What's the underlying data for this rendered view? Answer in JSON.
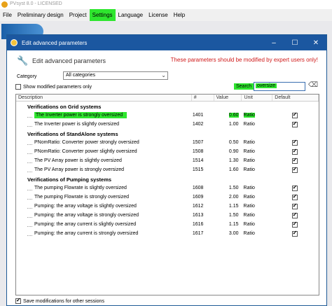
{
  "app": {
    "title": "PVsyst 8.0 - LICENSED",
    "menu": [
      "File",
      "Preliminary design",
      "Project",
      "Settings",
      "Language",
      "License",
      "Help"
    ]
  },
  "dialog": {
    "title": "Edit advanced parameters",
    "header": "Edit advanced parameters",
    "warning": "These parameters should be modified by expert users only!",
    "category_label": "Category",
    "category_value": "All categories",
    "show_modified_label": "Show modified parameters only",
    "search_label": "Search",
    "search_value": "oversize",
    "save_label": "Save modifications for other sessions"
  },
  "table": {
    "columns": [
      "Description",
      "#",
      "Value",
      "Unit",
      "Default"
    ],
    "groups": [
      {
        "title": "Verifications on Grid systems",
        "rows": [
          {
            "desc": "The Inverter power is strongly oversized",
            "num": "1401",
            "value": "0.60",
            "unit": "Ratio",
            "highlight": true
          },
          {
            "desc": "The Inverter power is slightly oversized",
            "num": "1402",
            "value": "1.00",
            "unit": "Ratio"
          }
        ]
      },
      {
        "title": "Verifications of StandAlone systems",
        "rows": [
          {
            "desc": "PNomRatio: Converter power strongly oversized",
            "num": "1507",
            "value": "0.50",
            "unit": "Ratio"
          },
          {
            "desc": "PNomRatio: Converter power slightly oversized",
            "num": "1508",
            "value": "0.90",
            "unit": "Ratio"
          },
          {
            "desc": "The PV Array power is slightly oversized",
            "num": "1514",
            "value": "1.30",
            "unit": "Ratio"
          },
          {
            "desc": "The PV Array power is strongly oversized",
            "num": "1515",
            "value": "1.60",
            "unit": "Ratio"
          }
        ]
      },
      {
        "title": "Verifications of Pumping systems",
        "rows": [
          {
            "desc": "The pumping Flowrate is slightly oversized",
            "num": "1608",
            "value": "1.50",
            "unit": "Ratio"
          },
          {
            "desc": "The pumping Flowrate is strongly oversized",
            "num": "1609",
            "value": "2.00",
            "unit": "Ratio"
          },
          {
            "desc": "Pumping: the array voltage is slightly oversized",
            "num": "1612",
            "value": "1.15",
            "unit": "Ratio"
          },
          {
            "desc": "Pumping: the array voltage is strongly oversized",
            "num": "1613",
            "value": "1.50",
            "unit": "Ratio"
          },
          {
            "desc": "Pumping: the array current is slightly oversized",
            "num": "1616",
            "value": "1.15",
            "unit": "Ratio"
          },
          {
            "desc": "Pumping: the array current is strongly oversized",
            "num": "1617",
            "value": "3.00",
            "unit": "Ratio"
          }
        ]
      }
    ]
  },
  "colors": {
    "highlight": "#2ee62e",
    "titlebar": "#1b57a0",
    "warning": "#d01a1a"
  }
}
